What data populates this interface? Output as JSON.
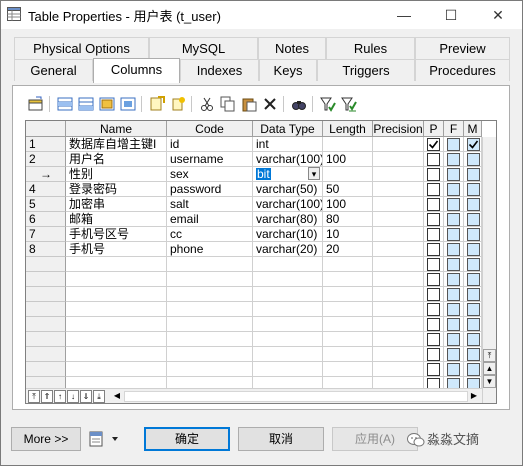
{
  "window": {
    "title": "Table Properties - 用户表 (t_user)"
  },
  "titlebar": {
    "minimize": "—",
    "maximize": "☐",
    "close": "✕"
  },
  "tabs": {
    "top": [
      "Physical Options",
      "MySQL",
      "Notes",
      "Rules",
      "Preview"
    ],
    "bottom": [
      "General",
      "Columns",
      "Indexes",
      "Keys",
      "Triggers",
      "Procedures"
    ],
    "active": "Columns"
  },
  "grid": {
    "headers": [
      "Name",
      "Code",
      "Data Type",
      "Length",
      "Precision",
      "P",
      "F",
      "M"
    ],
    "rows": [
      {
        "num": "1",
        "name": "数据库自增主键I",
        "code": "id",
        "type": "int",
        "length": "",
        "p": true,
        "f": false,
        "m": true
      },
      {
        "num": "2",
        "name": "用户名",
        "code": "username",
        "type": "varchar(100)",
        "length": "100",
        "p": false,
        "f": false,
        "m": false
      },
      {
        "num": "→",
        "name": "性别",
        "code": "sex",
        "type": "bit",
        "length": "",
        "p": false,
        "f": false,
        "m": false,
        "editing": true
      },
      {
        "num": "4",
        "name": "登录密码",
        "code": "password",
        "type": "varchar(50)",
        "length": "50",
        "p": false,
        "f": false,
        "m": false
      },
      {
        "num": "5",
        "name": "加密串",
        "code": "salt",
        "type": "varchar(100)",
        "length": "100",
        "p": false,
        "f": false,
        "m": false
      },
      {
        "num": "6",
        "name": "邮箱",
        "code": "email",
        "type": "varchar(80)",
        "length": "80",
        "p": false,
        "f": false,
        "m": false
      },
      {
        "num": "7",
        "name": "手机号区号",
        "code": "cc",
        "type": "varchar(10)",
        "length": "10",
        "p": false,
        "f": false,
        "m": false
      },
      {
        "num": "8",
        "name": "手机号",
        "code": "phone",
        "type": "varchar(20)",
        "length": "20",
        "p": false,
        "f": false,
        "m": false
      }
    ]
  },
  "buttons": {
    "more": "More >>",
    "ok": "确定",
    "cancel": "取消",
    "apply": "应用(A)"
  },
  "watermark": "淼淼文摘"
}
